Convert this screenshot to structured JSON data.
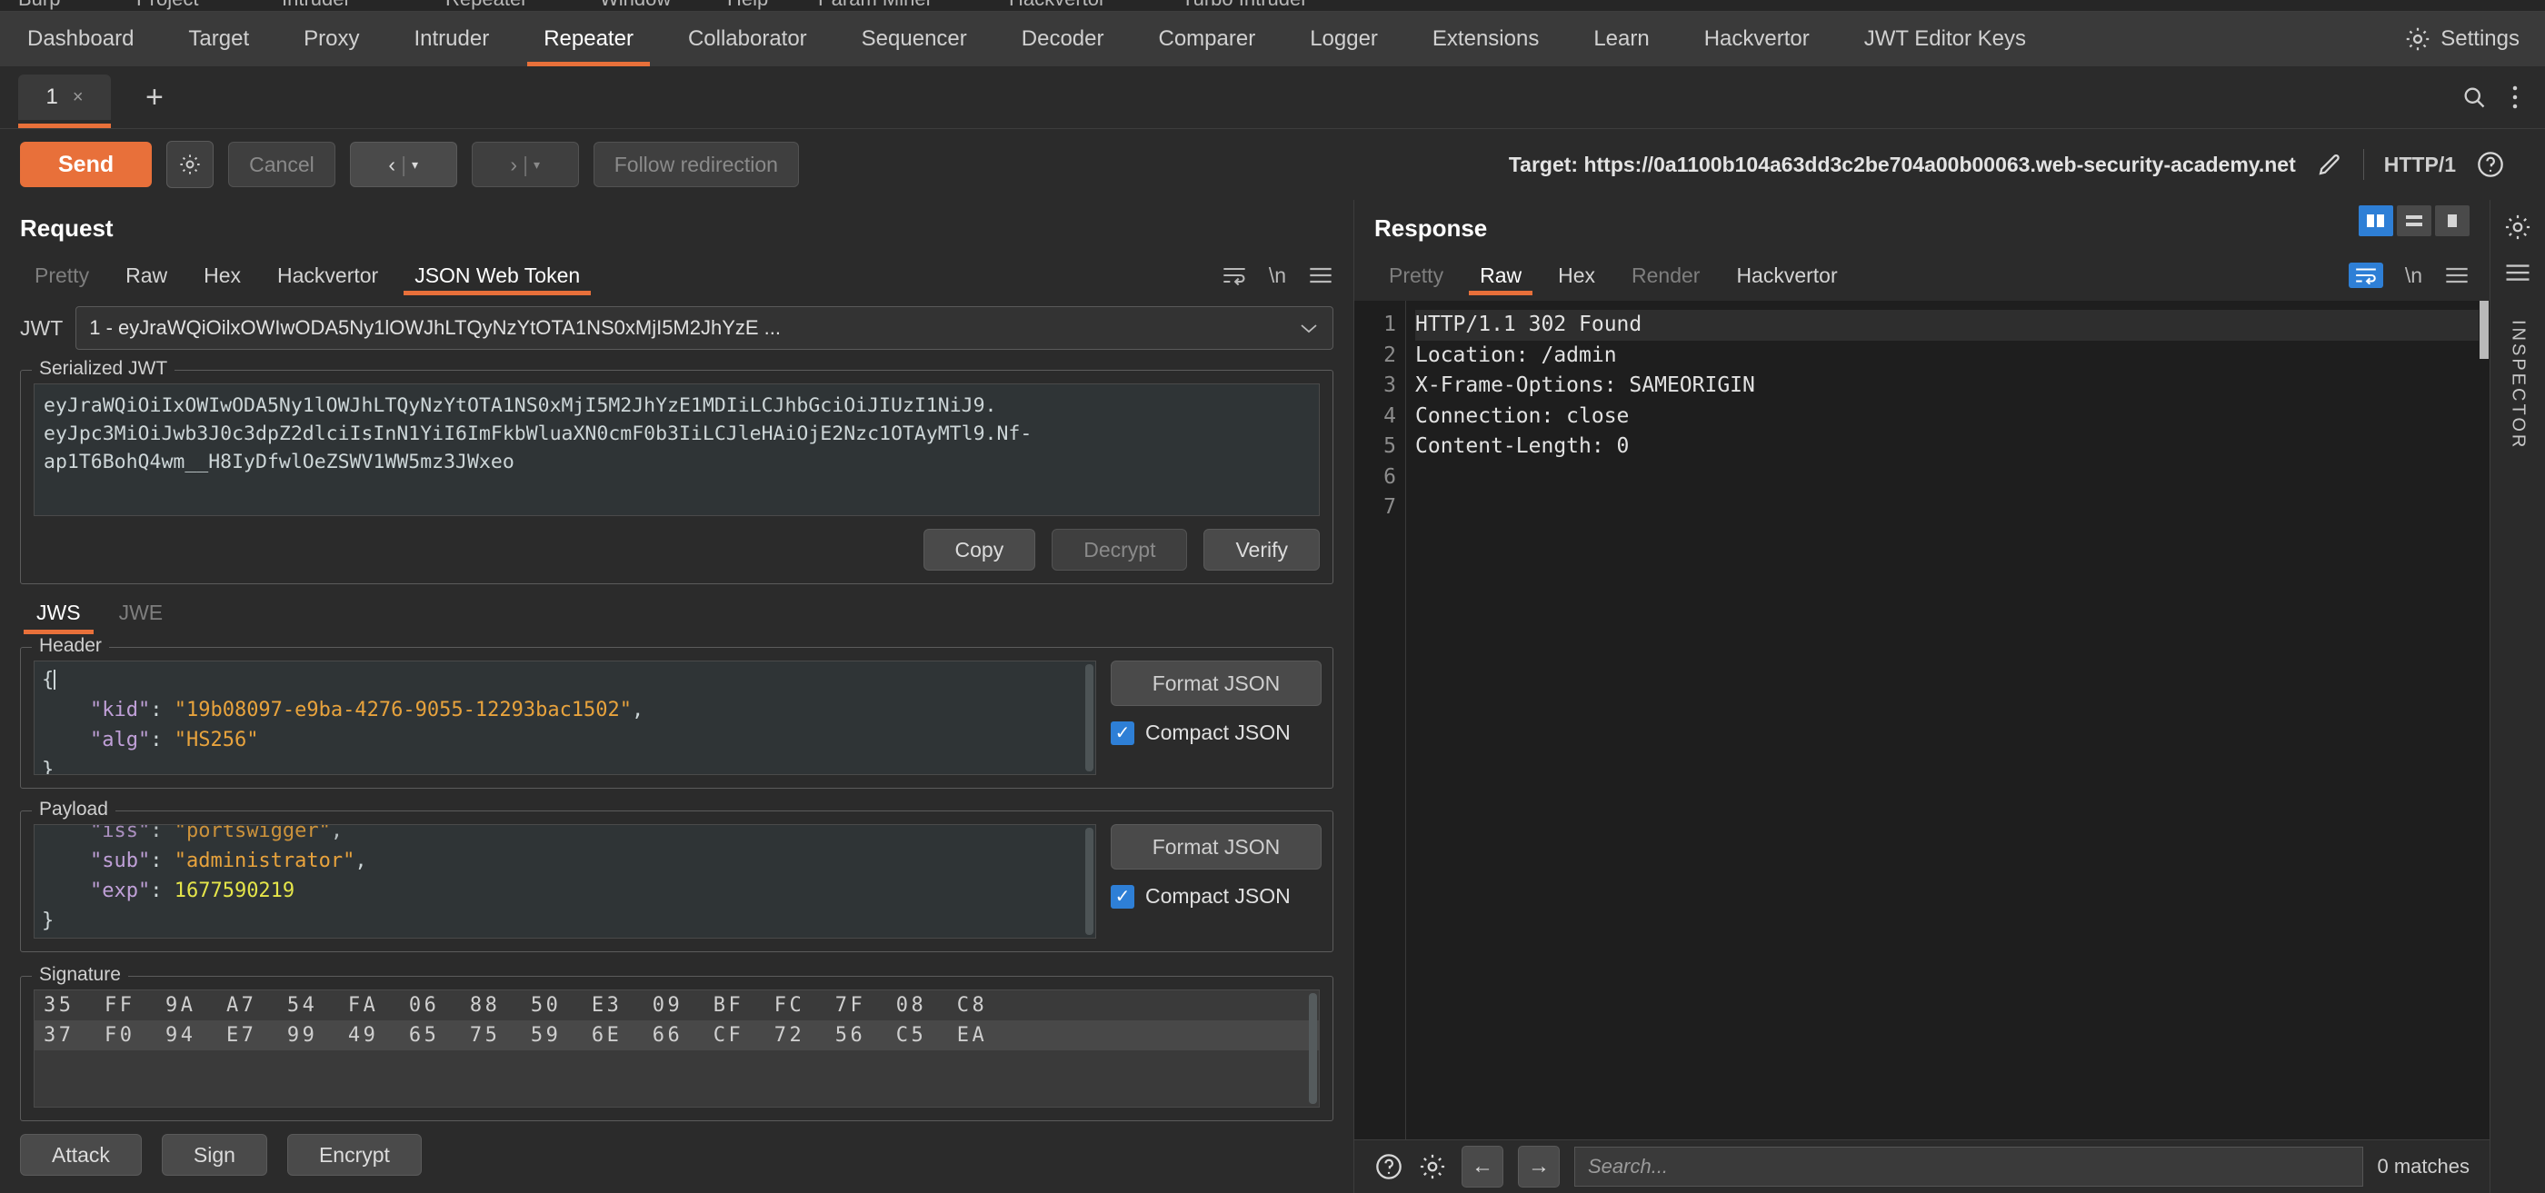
{
  "menubar": {
    "items": [
      "Burp",
      "Project",
      "Intruder",
      "Repeater",
      "Window",
      "Help",
      "Param Miner",
      "Hackvertor",
      "Turbo Intruder"
    ]
  },
  "nav": {
    "tabs": [
      "Dashboard",
      "Target",
      "Proxy",
      "Intruder",
      "Repeater",
      "Collaborator",
      "Sequencer",
      "Decoder",
      "Comparer",
      "Logger",
      "Extensions",
      "Learn",
      "Hackvertor",
      "JWT Editor Keys"
    ],
    "active": "Repeater",
    "settings_label": "Settings",
    "settings_icon": "gear-icon"
  },
  "tabstrip": {
    "tab_label": "1",
    "tab_close": "×",
    "add_label": "+",
    "search_icon": "search-icon",
    "menu_icon": "vertical-dots-icon"
  },
  "actionbar": {
    "send": "Send",
    "settings_icon": "gear-icon",
    "cancel": "Cancel",
    "prev": "‹",
    "next": "›",
    "caret": "▾",
    "follow_redirection": "Follow redirection",
    "target_label": "Target: https://0a1100b104a63dd3c2be704a00b00063.web-security-academy.net",
    "edit_icon": "pencil-icon",
    "http_version": "HTTP/1",
    "help_icon": "question-circle-icon"
  },
  "request": {
    "title": "Request",
    "tabs": [
      "Pretty",
      "Raw",
      "Hex",
      "Hackvertor",
      "JSON Web Token"
    ],
    "active_tab": "JSON Web Token",
    "disabled_tab": "Pretty",
    "jwt": {
      "label": "JWT",
      "selected": "1 - eyJraWQiOilxOWIwODA5Ny1lOWJhLTQyNzYtOTA1NS0xMjI5M2JhYzE ...",
      "chevron": "⌄"
    },
    "serialized": {
      "legend": "Serialized JWT",
      "line1": "eyJraWQiOiIxOWIwODA5Ny1lOWJhLTQyNzYtOTA1NS0xMjI5M2JhYzE1MDIiLCJhbGciOiJIUzI1NiJ9.",
      "line2": "eyJpc3MiOiJwb3J0c3dpZ2dlciIsInN1YiI6ImFkbWluaXN0cmF0b3IiLCJleHAiOjE2Nzc1OTAyMTl9.Nf-",
      "line3": "ap1T6BohQ4wm__H8IyDfwlOeZSWV1WW5mz3JWxeo",
      "copy": "Copy",
      "decrypt": "Decrypt",
      "verify": "Verify"
    },
    "jws_jwe": {
      "jws": "JWS",
      "jwe": "JWE",
      "active": "JWS"
    },
    "header": {
      "legend": "Header",
      "lines": [
        {
          "open": "{"
        },
        {
          "key": "\"kid\"",
          "colon": ": ",
          "value": "\"19b08097-e9ba-4276-9055-12293bac1502\"",
          "type": "string",
          "comma": ","
        },
        {
          "key": "\"alg\"",
          "colon": ": ",
          "value": "\"HS256\"",
          "type": "string",
          "comma": ""
        },
        {
          "close": "}"
        }
      ],
      "format_button": "Format JSON",
      "compact_label": "Compact JSON",
      "compact_checked": true
    },
    "payload": {
      "legend": "Payload",
      "lines": [
        {
          "key": "\"iss\"",
          "colon": ": ",
          "value": "\"portswigger\"",
          "type": "string",
          "comma": ","
        },
        {
          "key": "\"sub\"",
          "colon": ": ",
          "value": "\"administrator\"",
          "type": "string",
          "comma": ","
        },
        {
          "key": "\"exp\"",
          "colon": ": ",
          "value": "1677590219",
          "type": "number",
          "comma": ""
        },
        {
          "close": "}"
        }
      ],
      "format_button": "Format JSON",
      "compact_label": "Compact JSON",
      "compact_checked": true
    },
    "signature": {
      "legend": "Signature",
      "row1": "35  FF  9A  A7  54  FA  06  88  50  E3  09  BF  FC  7F  08  C8",
      "row2": "37  F0  94  E7  99  49  65  75  59  6E  66  CF  72  56  C5  EA"
    },
    "bottom_buttons": [
      "Attack",
      "Sign",
      "Encrypt"
    ]
  },
  "response": {
    "title": "Response",
    "tabs": [
      "Pretty",
      "Raw",
      "Hex",
      "Render",
      "Hackvertor"
    ],
    "active_tab": "Raw",
    "disabled_tabs": [
      "Pretty",
      "Render"
    ],
    "line_numbers": [
      "1",
      "2",
      "3",
      "4",
      "5",
      "6",
      "7"
    ],
    "lines": [
      "HTTP/1.1 302 Found",
      "Location: /admin",
      "X-Frame-Options: SAMEORIGIN",
      "Connection: close",
      "Content-Length: 0",
      "",
      ""
    ],
    "view_buttons": [
      "split-view-icon",
      "stacked-view-icon",
      "single-view-icon"
    ],
    "wrap_icon": "word-wrap-icon",
    "newline_label": "\\n",
    "menu_icon": "hamburger-icon",
    "footer": {
      "help_icon": "question-circle-icon",
      "settings_icon": "gear-icon",
      "back": "←",
      "forward": "→",
      "search_placeholder": "Search...",
      "search_value": "",
      "matches": "0 matches"
    }
  },
  "inspector": {
    "gear_icon": "gear-icon",
    "panel_icon": "panel-icon",
    "label": "INSPECTOR"
  },
  "colors": {
    "accent": "#e8703a",
    "checkbox": "#2e7fd6",
    "json_string": "#e8a33d",
    "json_key": "#c0a0d8",
    "json_number": "#e5e54a"
  }
}
